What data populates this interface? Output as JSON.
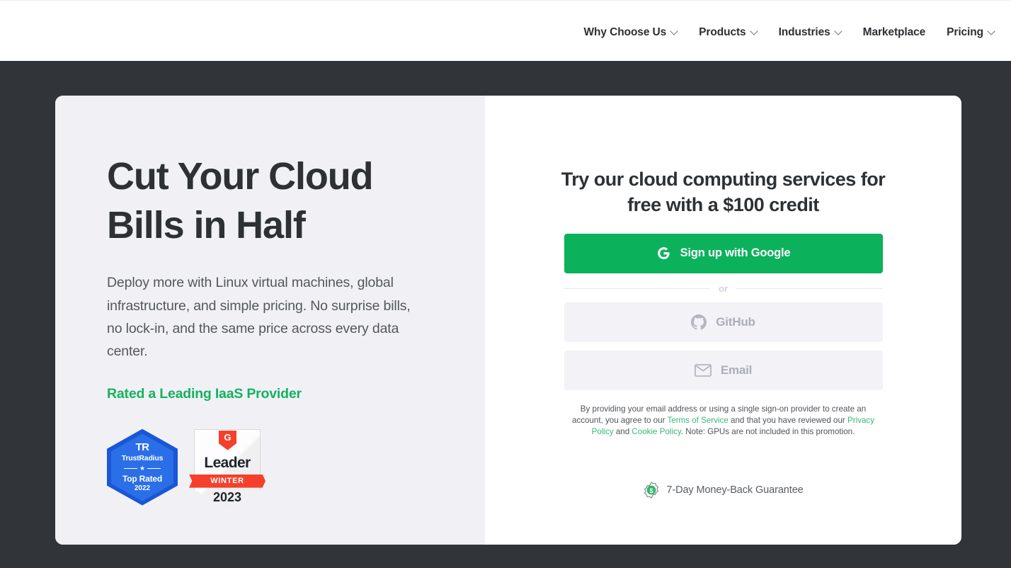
{
  "nav": {
    "items": [
      {
        "label": "Why Choose Us",
        "has_chevron": true,
        "icon": "chevron-down-icon"
      },
      {
        "label": "Products",
        "has_chevron": true,
        "icon": "chevron-down-icon"
      },
      {
        "label": "Industries",
        "has_chevron": true,
        "icon": "chevron-down-icon"
      },
      {
        "label": "Marketplace",
        "has_chevron": false,
        "icon": ""
      },
      {
        "label": "Pricing",
        "has_chevron": true,
        "icon": "chevron-down-icon"
      }
    ]
  },
  "hero": {
    "headline": "Cut Your Cloud Bills in Half",
    "subcopy": "Deploy more with Linux virtual machines, global infrastructure, and simple pricing. No surprise bills, no lock-in, and the same price across every data center.",
    "rated_label": "Rated a Leading IaaS Provider"
  },
  "badges": {
    "trustradius": {
      "icon": "trustradius-hexagon-badge-icon",
      "logo_mark": "TR",
      "brand": "TrustRadius",
      "star": "★",
      "award": "Top Rated",
      "year": "2022"
    },
    "g2": {
      "icon": "g2-leader-shield-badge-icon",
      "logo_mark": "G",
      "award": "Leader",
      "season": "WINTER",
      "year": "2023"
    }
  },
  "signup": {
    "title": "Try our cloud computing services for free with a $100 credit",
    "google_button": {
      "label": "Sign up with Google",
      "icon": "google-g-icon",
      "color": "#0cb15c"
    },
    "divider_label": "or",
    "github_button": {
      "label": "GitHub",
      "icon": "github-icon"
    },
    "email_button": {
      "label": "Email",
      "icon": "envelope-icon"
    },
    "legal": {
      "part1": "By providing your email address or using a single sign-on provider to create an account, you agree to our ",
      "terms_link": "Terms of Service",
      "part2": " and that you have reviewed our ",
      "privacy_link": "Privacy Policy",
      "part3": " and ",
      "cookie_link": "Cookie Policy",
      "part4": ". Note: GPUs are not included in this promotion.",
      "link_color": "#38b877"
    },
    "guarantee": {
      "label": "7-Day Money-Back Guarantee",
      "icon": "money-back-seal-icon"
    }
  },
  "theme": {
    "band_background": "#313438",
    "left_panel_background": "#f1f1f5",
    "right_panel_background": "#ffffff",
    "accent_green": "#16b160",
    "heading_color": "#2e3134"
  }
}
